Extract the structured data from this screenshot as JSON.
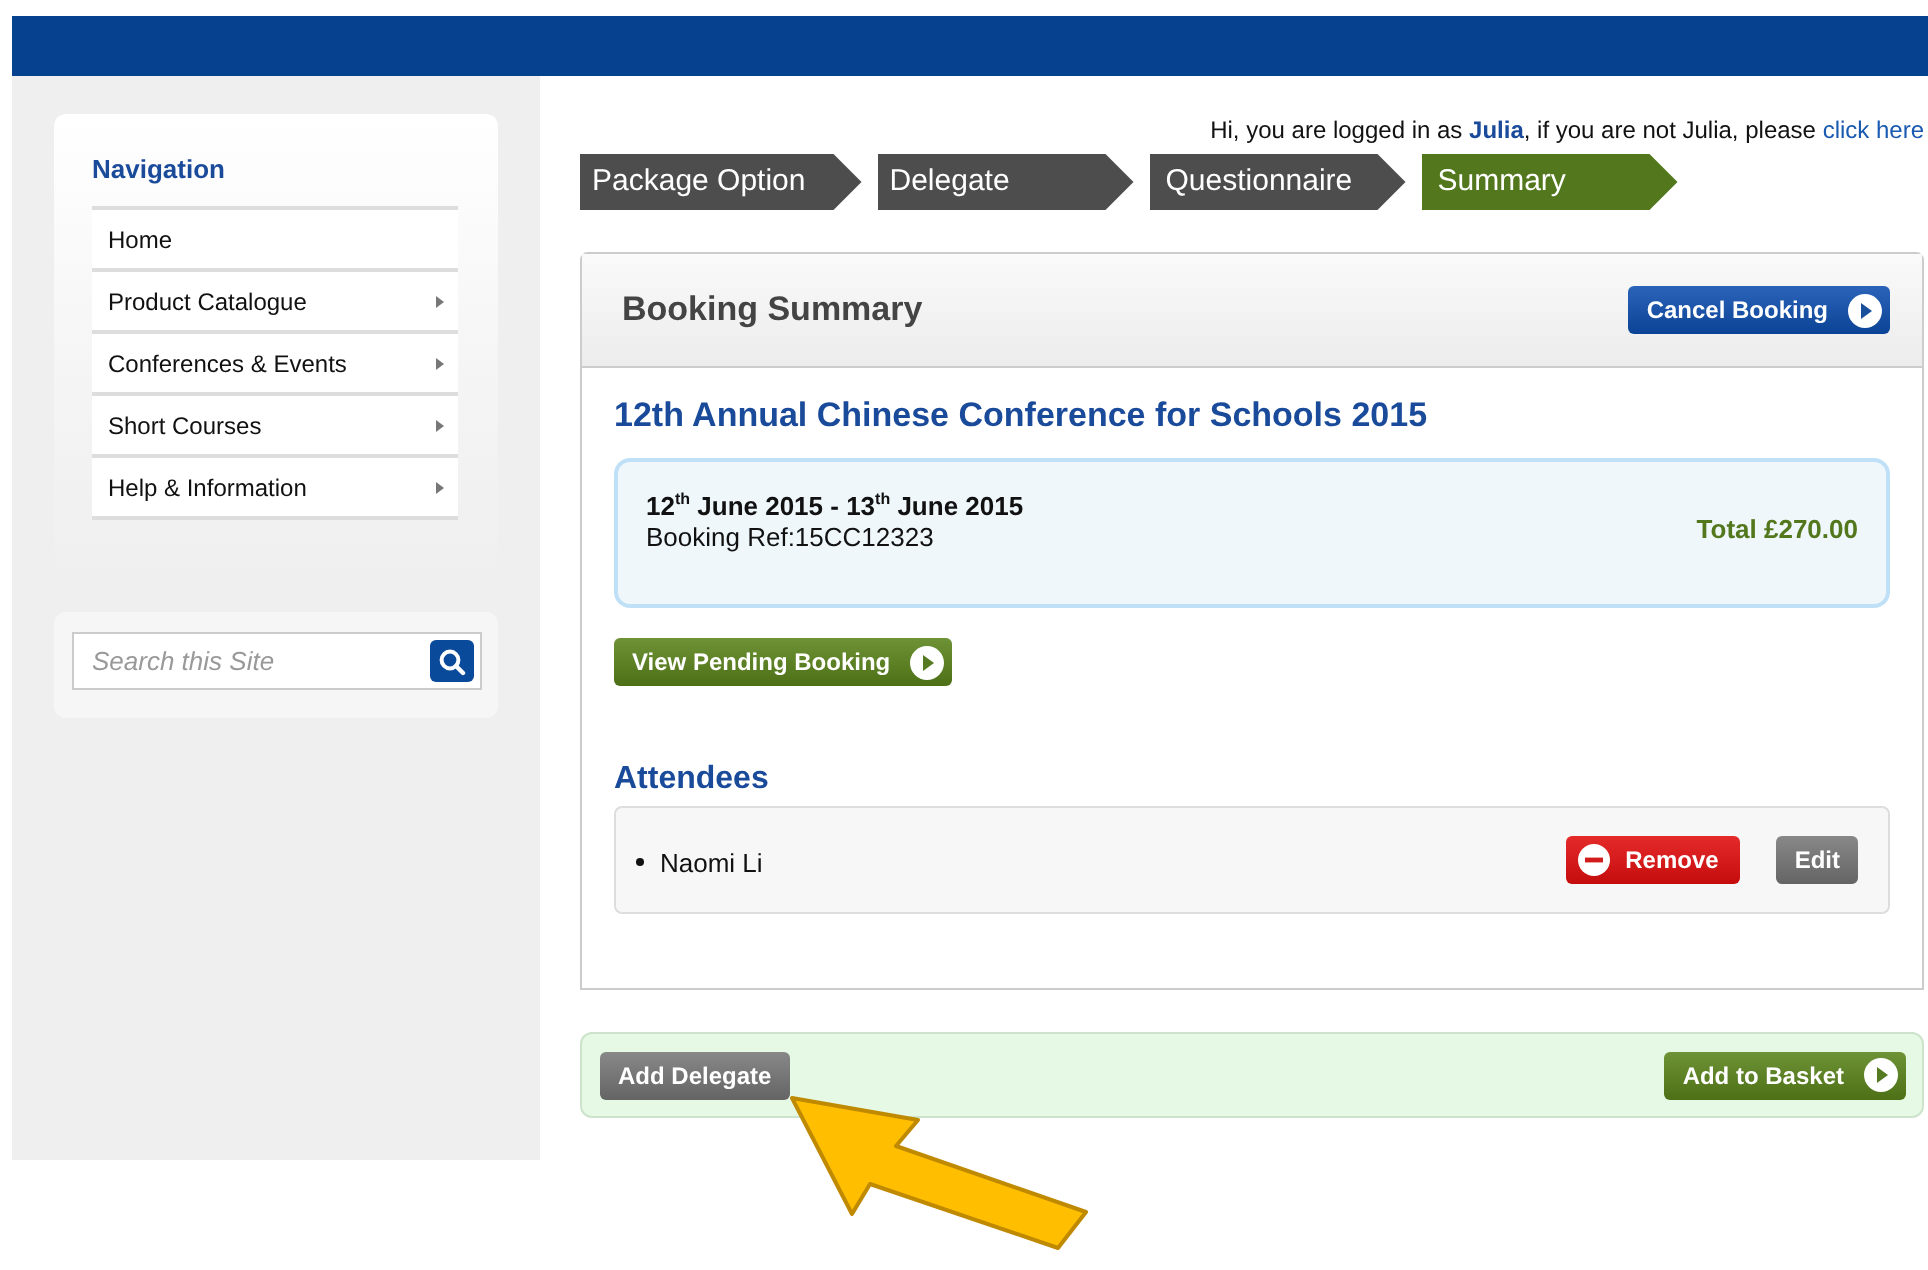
{
  "navigation": {
    "title": "Navigation",
    "items": [
      {
        "label": "Home",
        "has_submenu": false
      },
      {
        "label": "Product Catalogue",
        "has_submenu": true
      },
      {
        "label": "Conferences & Events",
        "has_submenu": true
      },
      {
        "label": "Short Courses",
        "has_submenu": true
      },
      {
        "label": "Help & Information",
        "has_submenu": true
      }
    ]
  },
  "search": {
    "placeholder": "Search this Site"
  },
  "greeting": {
    "text": "Hi, you are logged in as **Julia**, if you are not Julia, please",
    "link": "click here"
  },
  "steps": [
    {
      "label": "Package Option",
      "selected": false
    },
    {
      "label": "Delegate",
      "selected": false
    },
    {
      "label": "Questionnaire",
      "selected": false
    },
    {
      "label": "Summary",
      "selected": true
    }
  ],
  "booking": {
    "title": "Booking Summary",
    "cancel_button": "Cancel Booking",
    "event_title": "12th Annual Chinese Conference for Schools 2015",
    "dates": "12$^{th}$ June 2015 - 13$^{th}$ June 2015",
    "reference": "Booking Ref:15CC12323",
    "total": "Total £270.00",
    "pending_button": "View Pending Booking"
  },
  "attendees": {
    "title": "Attendees",
    "items": [
      {
        "name": "Naomi Li",
        "remove": "Remove",
        "edit": "Edit"
      }
    ]
  },
  "footer": {
    "add_delegate": "Add Delegate",
    "add_to_basket": "Add to Basket"
  },
  "annotation": {
    "kind": "arrow"
  }
}
